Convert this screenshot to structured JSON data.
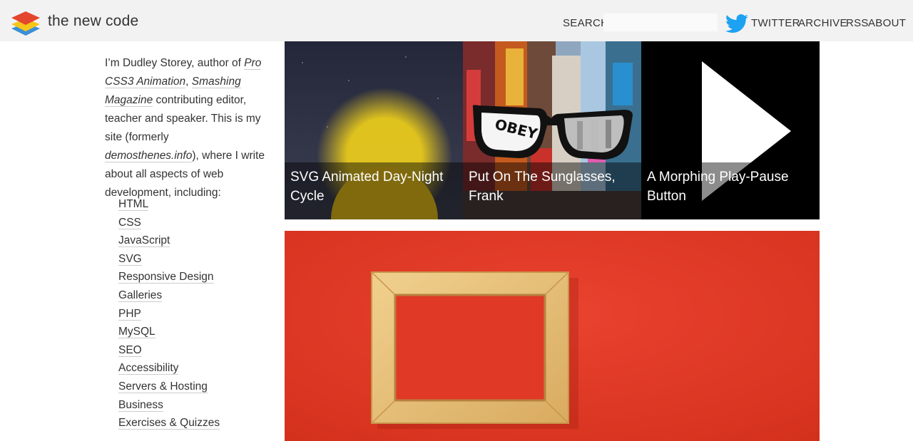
{
  "header": {
    "site_title": "the new code",
    "search_label": "SEARCH",
    "search_placeholder": "",
    "nav": {
      "twitter": "TWITTER",
      "archive": "ARCHIVE",
      "rss": "RSS",
      "about": "ABOUT"
    },
    "icons": [
      "layered-logo-icon",
      "twitter-bird-icon"
    ]
  },
  "intro": {
    "p1": "I’m Dudley Storey, author of ",
    "book": "Pro CSS3 Animation",
    "sep": ", ",
    "mag": "Smashing Magazine",
    "p2": " contributing editor, teacher and speaker. This is my site (formerly ",
    "old_site": "demosthenes.info",
    "p3": "), where I write about all aspects of web development, including:"
  },
  "topics": [
    "HTML",
    "CSS",
    "JavaScript",
    "SVG",
    "Responsive Design",
    "Galleries",
    "PHP",
    "MySQL",
    "SEO",
    "Accessibility",
    "Servers & Hosting",
    "Business",
    "Exercises & Quizzes"
  ],
  "articles": [
    {
      "title": "SVG Animated Day-Night Cycle"
    },
    {
      "title": "Put On The Sunglasses, Frank"
    },
    {
      "title": "A Morphing Play-Pause Button"
    }
  ],
  "glasses_text": "OBEY",
  "colors": {
    "header_bg": "#f2f2f2",
    "twitter_blue": "#1da1f2",
    "feature_red": "#e33a26",
    "frame_wood": "#e6c37b"
  }
}
